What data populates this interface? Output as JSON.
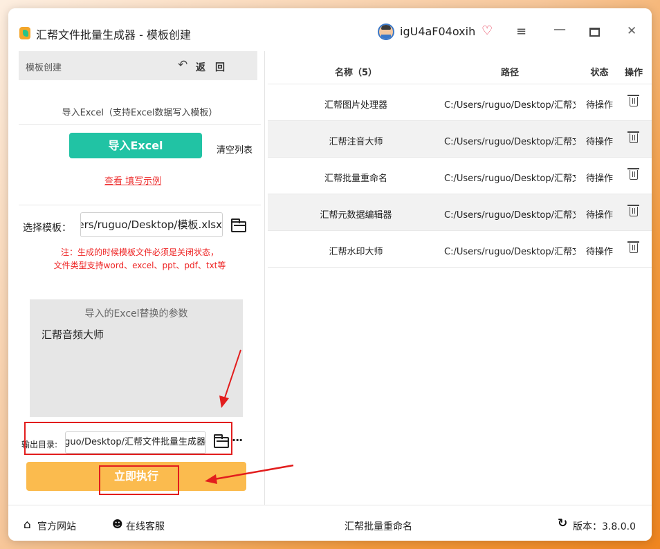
{
  "window": {
    "title": "汇帮文件批量生成器 - 模板创建",
    "username": "igU4aF04oxih"
  },
  "left": {
    "header_title": "模板创建",
    "back_label": "返回",
    "import_hint": "导入Excel（支持Excel数据写入模板）",
    "import_button": "导入Excel",
    "clear_list": "清空列表",
    "example_link": "查看 填写示例",
    "template_label": "选择模板：",
    "template_value": "C:/Users/ruguo/Desktop/模板.xlsx",
    "note_line1": "注：生成的时候模板文件必须是关闭状态，",
    "note_line2": "文件类型支持word、excel、ppt、pdf、txt等",
    "param_title": "导入的Excel替换的参数",
    "param_value": "汇帮音频大师",
    "output_label": "输出目录:",
    "output_value": "C:/Users/ruguo/Desktop/汇帮文件批量生成器",
    "more_label": "···",
    "run_button": "立即执行"
  },
  "table": {
    "headers": {
      "name": "名称（5）",
      "path": "路径",
      "status": "状态",
      "op": "操作"
    },
    "rows": [
      {
        "name": "汇帮图片处理器",
        "path": "C:/Users/ruguo/Desktop/汇帮文",
        "status": "待操作"
      },
      {
        "name": "汇帮注音大师",
        "path": "C:/Users/ruguo/Desktop/汇帮文",
        "status": "待操作"
      },
      {
        "name": "汇帮批量重命名",
        "path": "C:/Users/ruguo/Desktop/汇帮文",
        "status": "待操作"
      },
      {
        "name": "汇帮元数据编辑器",
        "path": "C:/Users/ruguo/Desktop/汇帮文",
        "status": "待操作"
      },
      {
        "name": "汇帮水印大师",
        "path": "C:/Users/ruguo/Desktop/汇帮文",
        "status": "待操作"
      }
    ]
  },
  "footer": {
    "official_site": "官方网站",
    "online_service": "在线客服",
    "center_text": "汇帮批量重命名",
    "version": "版本：3.8.0.0"
  },
  "icons": {
    "app": "app-logo-icon",
    "vip": "vip-heart-icon",
    "menu": "hamburger-menu-icon",
    "minimize": "minimize-icon",
    "maximize": "maximize-icon",
    "close": "close-icon",
    "back": "back-arrow-icon",
    "folder": "folder-open-icon",
    "trash": "trash-icon",
    "home": "home-icon",
    "service": "customer-service-icon",
    "refresh": "refresh-icon"
  },
  "colors": {
    "primary_button": "#21c3a4",
    "run_button": "#fbbb4e",
    "warning_text": "#e22222",
    "annotation": "#e21d1d"
  }
}
